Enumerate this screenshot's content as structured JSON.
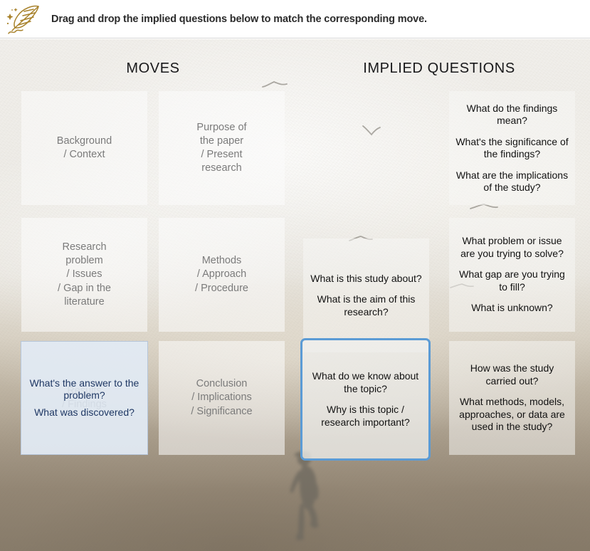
{
  "header": {
    "icon": "quill-feather-icon",
    "instruction": "Drag and drop the implied questions below to match the corresponding move."
  },
  "board": {
    "headings": {
      "moves": "MOVES",
      "implied_questions": "IMPLIED QUESTIONS"
    },
    "colors": {
      "selected_border": "#5b9bd5",
      "drag_fill": "#dfe8f3",
      "drag_text": "#1f3864",
      "move_text": "#7b7b7b",
      "question_text": "#121212",
      "quill_gold": "#a8822b"
    },
    "moves": [
      {
        "label": "Background\n/ Context"
      },
      {
        "label": "Purpose of\nthe paper\n/ Present\nresearch"
      },
      {
        "label": "Research\nproblem\n/ Issues\n/ Gap in the\nliterature"
      },
      {
        "label": "Methods\n/ Approach\n/ Procedure"
      },
      {
        "label": "Results\n/ Findings"
      },
      {
        "label": "Conclusion\n/ Implications\n/ Significance"
      }
    ],
    "question_cards": [
      {
        "id": "card-findings-meaning",
        "selected": false,
        "lines": [
          "What do the findings mean?",
          "What's the significance of the findings?",
          "What are the implications of the study?"
        ]
      },
      {
        "id": "card-study-about",
        "selected": false,
        "lines": [
          "What is this study about?",
          "What is the aim of this research?"
        ]
      },
      {
        "id": "card-problem-gap",
        "selected": false,
        "lines": [
          "What problem or issue are you trying to solve?",
          "What gap are you trying to fill?",
          "What is unknown?"
        ]
      },
      {
        "id": "card-know-topic",
        "selected": true,
        "lines": [
          "What do we know about the topic?",
          "Why is this topic / research important?"
        ]
      },
      {
        "id": "card-methods-used",
        "selected": false,
        "lines": [
          "How was the study carried out?",
          "What methods, models, approaches, or data are used in the study?"
        ]
      }
    ],
    "dragged_card": {
      "id": "card-answer-problem",
      "lines": [
        "What's the answer to the problem?",
        "What was discovered?"
      ]
    },
    "scene": {
      "description": "misty-beach-background",
      "child_silhouette": "running-child-silhouette",
      "birds": 4
    }
  }
}
